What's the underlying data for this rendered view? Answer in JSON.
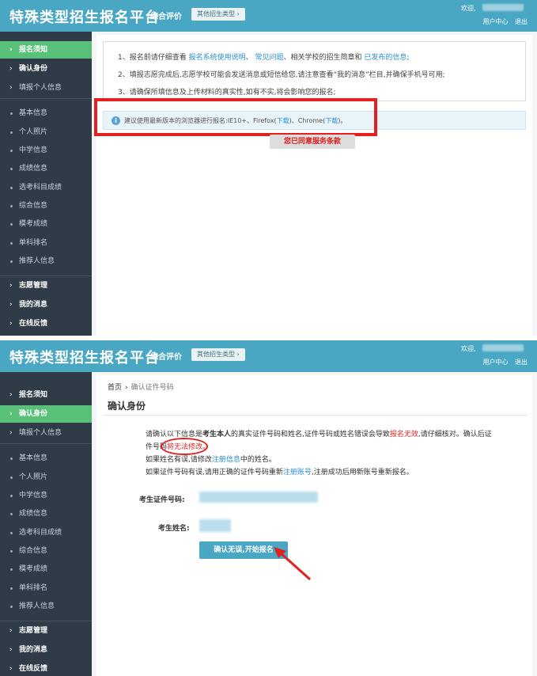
{
  "header": {
    "title": "特殊类型招生报名平台",
    "subtitle": "综合评价",
    "other_types_button": "其他招生类型 ›",
    "welcome": "欢迎,",
    "user_center": "用户中心",
    "logout": "退出"
  },
  "sidebar": {
    "application_notice": "报名须知",
    "confirm_identity": "确认身份",
    "fill_personal_info": "填报个人信息",
    "sub_items": [
      "基本信息",
      "个人照片",
      "中学信息",
      "成绩信息",
      "选考科目成绩",
      "综合信息",
      "模考成绩",
      "单科排名",
      "推荐人信息"
    ],
    "volunteer_management": "志愿管理",
    "my_messages": "我的消息",
    "online_feedback": "在线反馈"
  },
  "notice_page": {
    "line1_prefix": "1、报名前请仔细查看",
    "line1_link1": "报名系统使用说明",
    "line1_sep1": "、",
    "line1_link2": "常见问题",
    "line1_mid": "、相关学校的招生简章和",
    "line1_link3": "已发布的信息",
    "line1_suffix": ";",
    "line2": "2、填报志愿完成后,志愿学校可能会发送消息或短信给您,请注意查看“我的消息”栏目,并确保手机号可用;",
    "line3": "3、请确保所填信息及上传材料的真实性,如有不实,将会影响您的报名;",
    "tip_prefix": "建议使用最新版本的浏览器进行报名:IE10+、Firefox(",
    "tip_download1": "下载",
    "tip_mid": ")、Chrome(",
    "tip_download2": "下载",
    "tip_suffix": ")。",
    "agree_button": "您已同意服务条款"
  },
  "confirm_page": {
    "breadcrumb_home": "首页",
    "breadcrumb_sep": "›",
    "breadcrumb_current": "确认证件号码",
    "title": "确认身份",
    "p1_a": "请确认以下信息是",
    "p1_bold": "考生本人",
    "p1_b": "的真实证件号码和姓名,证件号码或姓名错误会导致",
    "p1_red": "报名无效",
    "p1_c": ",请仔细核对。确认后证",
    "p2_a": "件号码",
    "p2_red": "将无法修改。",
    "p3_a": "如果姓名有误,请修改",
    "p3_link": "注册信息",
    "p3_b": "中的姓名。",
    "p4_a": "如果证件号码有误,请用正确的证件号码重新",
    "p4_link": "注册账号",
    "p4_b": ",注册成功后用新账号重新报名。",
    "id_label": "考生证件号码:",
    "name_label": "考生姓名:",
    "confirm_button": "确认无误,开始报名"
  },
  "colors": {
    "header": "#4aa7c4",
    "sidebar": "#2f3c47",
    "active_item": "#59c07a",
    "annotation_red": "#e41f1f",
    "link": "#2a8fd0"
  }
}
